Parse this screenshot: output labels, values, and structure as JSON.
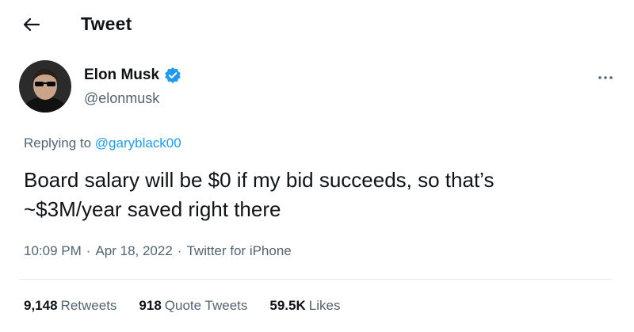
{
  "header": {
    "title": "Tweet",
    "back_icon": "back-arrow-icon"
  },
  "author": {
    "name": "Elon Musk",
    "handle": "@elonmusk",
    "verified_icon": "verified-badge-icon",
    "avatar_icon": "avatar-icon"
  },
  "tweet": {
    "reply_prefix": "Replying to",
    "reply_to": "@garyblack00",
    "text_line1": "Board salary will be $0 if my bid succeeds, so that’s",
    "text_line2": "~$3M/year saved right there",
    "time": "10:09 PM",
    "date": "Apr 18, 2022",
    "source": "Twitter for iPhone",
    "meta_separator": "·"
  },
  "stats": {
    "retweets_count": "9,148",
    "retweets_label": "Retweets",
    "quotes_count": "918",
    "quotes_label": "Quote Tweets",
    "likes_count": "59.5K",
    "likes_label": "Likes"
  },
  "colors": {
    "accent": "#1d9bf0",
    "text": "#0f1419",
    "secondary": "#536471",
    "divider": "#e6ecf0"
  }
}
